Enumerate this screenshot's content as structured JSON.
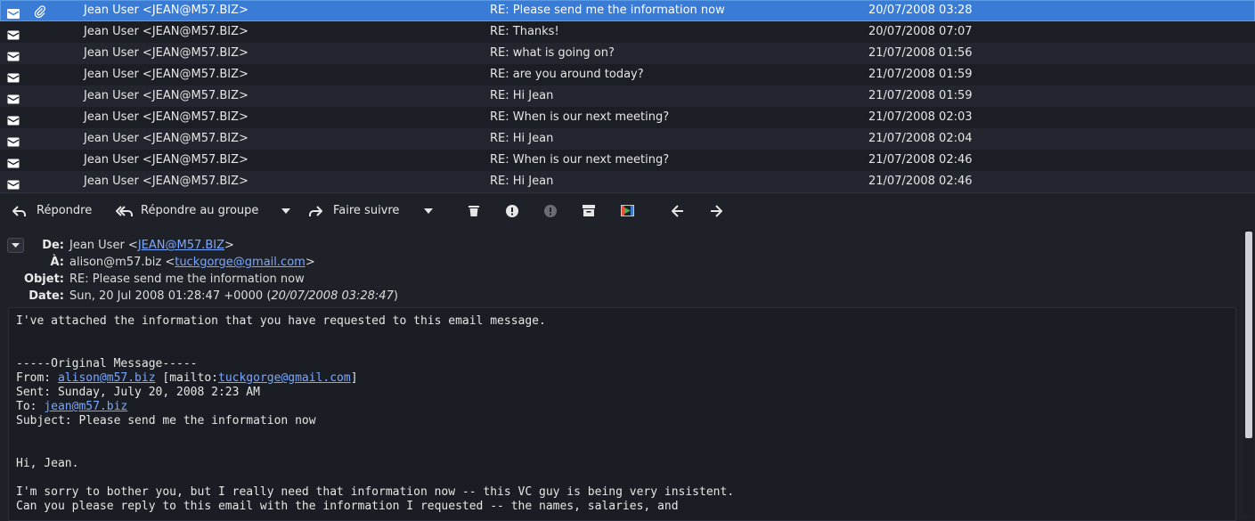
{
  "messages": [
    {
      "from": "Jean User <JEAN@M57.BIZ>",
      "subject": "RE: Please send me the information now",
      "date": "20/07/2008 03:28",
      "attachment": true,
      "selected": true
    },
    {
      "from": "Jean User <JEAN@M57.BIZ>",
      "subject": "RE: Thanks!",
      "date": "20/07/2008 07:07"
    },
    {
      "from": "Jean User <JEAN@M57.BIZ>",
      "subject": "RE: what is going on?",
      "date": "21/07/2008 01:56"
    },
    {
      "from": "Jean User <JEAN@M57.BIZ>",
      "subject": "RE: are you around today?",
      "date": "21/07/2008 01:59"
    },
    {
      "from": "Jean User <JEAN@M57.BIZ>",
      "subject": "RE: Hi Jean",
      "date": "21/07/2008 01:59"
    },
    {
      "from": "Jean User <JEAN@M57.BIZ>",
      "subject": "RE: When is our next meeting?",
      "date": "21/07/2008 02:03"
    },
    {
      "from": "Jean User <JEAN@M57.BIZ>",
      "subject": "RE: Hi Jean",
      "date": "21/07/2008 02:04"
    },
    {
      "from": "Jean User <JEAN@M57.BIZ>",
      "subject": "RE: When is our next meeting?",
      "date": "21/07/2008 02:46"
    },
    {
      "from": "Jean User <JEAN@M57.BIZ>",
      "subject": "RE: Hi Jean",
      "date": "21/07/2008 02:46"
    }
  ],
  "toolbar": {
    "reply": "Répondre",
    "reply_all": "Répondre au groupe",
    "forward": "Faire suivre"
  },
  "header": {
    "from_label": "De:",
    "from_name": "Jean User <",
    "from_email": "JEAN@M57.BIZ",
    "from_close": ">",
    "to_label": "À:",
    "to_name": "alison@m57.biz <",
    "to_email": "tuckgorge@gmail.com",
    "to_close": ">",
    "subject_label": "Objet:",
    "subject": "RE: Please send me the information now",
    "date_label": "Date:",
    "date": "Sun, 20 Jul 2008 01:28:47 +0000 (",
    "date_local": "20/07/2008 03:28:47",
    "date_close": ")"
  },
  "body": {
    "line1": "I've attached the information that you have requested to this email message.",
    "orig_header": "-----Original Message-----",
    "from_prefix": "From: ",
    "from_email": "alison@m57.biz",
    "from_mailto": " [mailto:",
    "from_mailto_email": "tuckgorge@gmail.com",
    "from_mailto_close": "]",
    "sent": "Sent: Sunday, July 20, 2008 2:23 AM",
    "to_prefix": "To: ",
    "to_email": "jean@m57.biz",
    "subject": "Subject: Please send me the information now",
    "greeting": "Hi, Jean.",
    "para1": "I'm sorry to bother you, but I really need that information now -- this VC guy is being very insistent.",
    "para2": "Can you please reply to this email with the information I requested -- the names, salaries, and"
  },
  "colors": {
    "selection": "#3a7bd5",
    "link": "#7aa7ff",
    "background": "#1e2128"
  }
}
